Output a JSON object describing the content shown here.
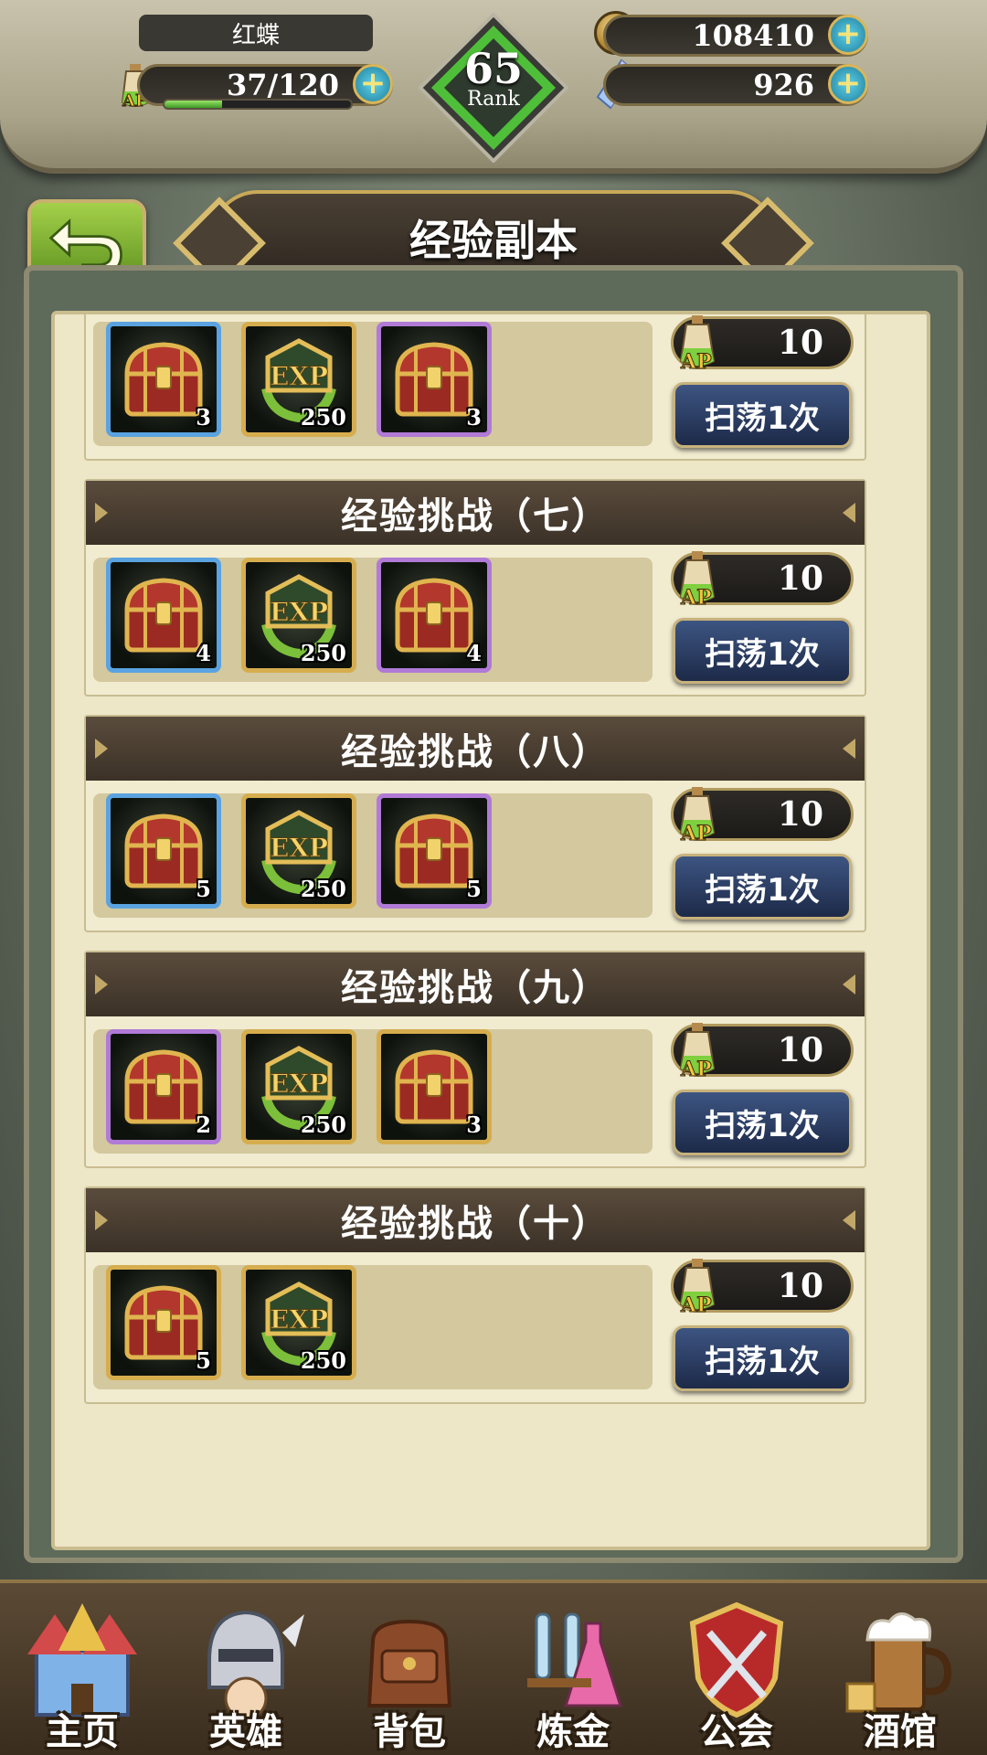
{
  "hud": {
    "player_name": "红蝶",
    "ap": "37/120",
    "ap_fraction": 0.31,
    "gold": "108410",
    "gems": "926",
    "rank_value": "65",
    "rank_label": "Rank",
    "plus_label": "+",
    "ap_icon_label": "AP"
  },
  "title": "经验副本",
  "stages": [
    {
      "title": "",
      "rewards": [
        {
          "icon": "chest-icon",
          "frame": "blue",
          "count": "3"
        },
        {
          "icon": "exp-badge-icon",
          "frame": "gold",
          "count": "250"
        },
        {
          "icon": "chest-icon",
          "frame": "purple",
          "count": "3"
        }
      ],
      "ap_cost": "10",
      "sweep_label": "扫荡1次"
    },
    {
      "title": "经验挑战（七）",
      "rewards": [
        {
          "icon": "chest-icon",
          "frame": "blue",
          "count": "4"
        },
        {
          "icon": "exp-badge-icon",
          "frame": "gold",
          "count": "250"
        },
        {
          "icon": "chest-icon",
          "frame": "purple",
          "count": "4"
        }
      ],
      "ap_cost": "10",
      "sweep_label": "扫荡1次"
    },
    {
      "title": "经验挑战（八）",
      "rewards": [
        {
          "icon": "chest-icon",
          "frame": "blue",
          "count": "5"
        },
        {
          "icon": "exp-badge-icon",
          "frame": "gold",
          "count": "250"
        },
        {
          "icon": "chest-icon",
          "frame": "purple",
          "count": "5"
        }
      ],
      "ap_cost": "10",
      "sweep_label": "扫荡1次"
    },
    {
      "title": "经验挑战（九）",
      "rewards": [
        {
          "icon": "chest-icon",
          "frame": "purple",
          "count": "2"
        },
        {
          "icon": "exp-badge-icon",
          "frame": "gold",
          "count": "250"
        },
        {
          "icon": "chest-icon",
          "frame": "gold",
          "count": "3"
        }
      ],
      "ap_cost": "10",
      "sweep_label": "扫荡1次"
    },
    {
      "title": "经验挑战（十）",
      "rewards": [
        {
          "icon": "chest-icon",
          "frame": "gold",
          "count": "5"
        },
        {
          "icon": "exp-badge-icon",
          "frame": "gold",
          "count": "250"
        }
      ],
      "ap_cost": "10",
      "sweep_label": "扫荡1次"
    }
  ],
  "nav": [
    {
      "label": "主页",
      "icon": "castle-icon"
    },
    {
      "label": "英雄",
      "icon": "knight-helmet-icon"
    },
    {
      "label": "背包",
      "icon": "backpack-icon"
    },
    {
      "label": "炼金",
      "icon": "potion-flasks-icon"
    },
    {
      "label": "公会",
      "icon": "guild-shield-icon"
    },
    {
      "label": "酒馆",
      "icon": "tavern-beer-icon"
    }
  ],
  "colors": {
    "panel": "#ede6c7",
    "stage_header": "#3b3127",
    "sweep_button": "#1d2a48",
    "rank_green": "#4fbf3a"
  }
}
